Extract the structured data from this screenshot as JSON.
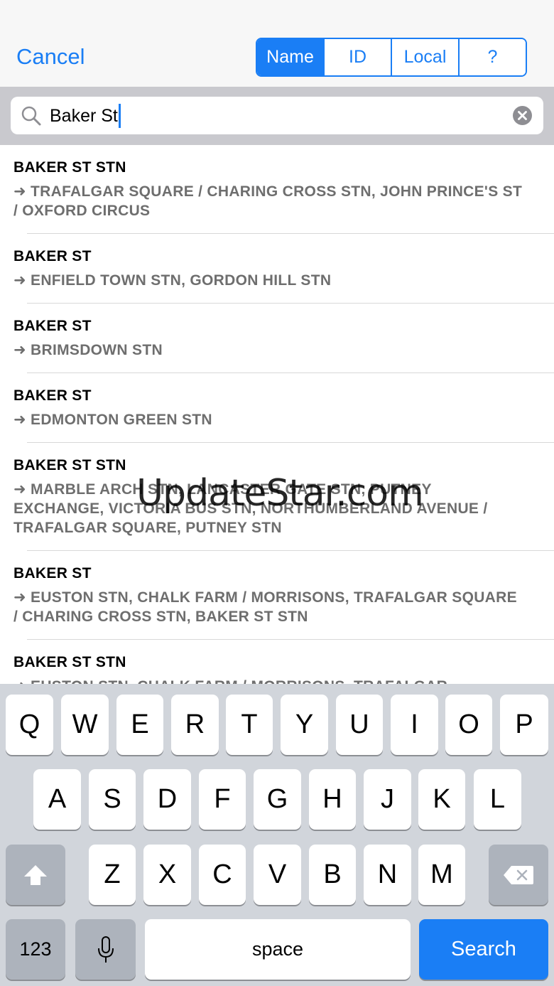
{
  "nav": {
    "cancel_label": "Cancel",
    "segments": [
      "Name",
      "ID",
      "Local",
      "?"
    ],
    "active_segment": "Name"
  },
  "search": {
    "value": "Baker St"
  },
  "results": [
    {
      "title": "BAKER ST STN",
      "destination": "➜ TRAFALGAR SQUARE / CHARING CROSS STN, JOHN PRINCE'S ST / OXFORD CIRCUS"
    },
    {
      "title": "BAKER ST",
      "destination": "➜ ENFIELD TOWN STN, GORDON HILL STN"
    },
    {
      "title": "BAKER ST",
      "destination": "➜ BRIMSDOWN STN"
    },
    {
      "title": "BAKER ST",
      "destination": "➜ EDMONTON GREEN STN"
    },
    {
      "title": "BAKER ST STN",
      "destination": "➜ MARBLE ARCH STN, LANCASTER GATE STN, PUTNEY EXCHANGE, VICTORIA BUS STN, NORTHUMBERLAND AVENUE / TRAFALGAR SQUARE, PUTNEY STN"
    },
    {
      "title": "BAKER ST",
      "destination": "➜ EUSTON STN, CHALK FARM / MORRISONS, TRAFALGAR SQUARE / CHARING CROSS STN, BAKER ST STN"
    },
    {
      "title": "BAKER ST STN",
      "destination": "➜ EUSTON STN, CHALK FARM / MORRISONS, TRAFALGAR"
    }
  ],
  "watermark": "UpdateStar.com",
  "keyboard": {
    "row1": [
      "Q",
      "W",
      "E",
      "R",
      "T",
      "Y",
      "U",
      "I",
      "O",
      "P"
    ],
    "row2": [
      "A",
      "S",
      "D",
      "F",
      "G",
      "H",
      "J",
      "K",
      "L"
    ],
    "row3": [
      "Z",
      "X",
      "C",
      "V",
      "B",
      "N",
      "M"
    ],
    "numbers_label": "123",
    "space_label": "space",
    "search_label": "Search"
  },
  "colors": {
    "accent": "#1a7ef5",
    "keyboard_bg": "#d1d5db",
    "search_bar_bg": "#c9c9ce"
  }
}
